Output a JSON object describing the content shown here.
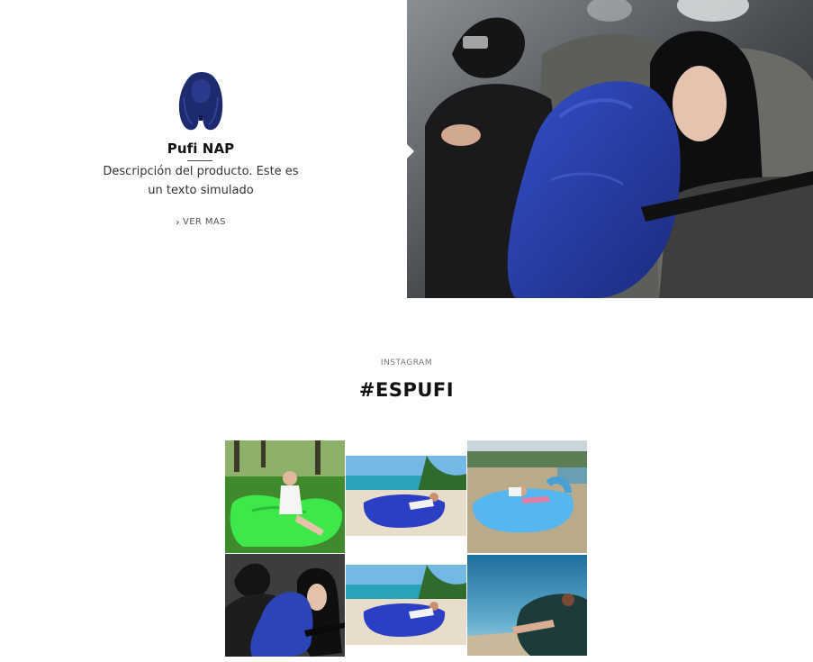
{
  "product": {
    "name": "Pufi NAP",
    "description": "Descripción del producto. Este es un texto simulado",
    "cta_label": "VER MAS",
    "cta_icon": "chevron-right-icon",
    "thumbnail": "inflatable-pillow-navy",
    "hero_image": "passengers-with-inflatable-pillow-on-plane"
  },
  "instagram": {
    "kicker": "INSTAGRAM",
    "heading": "#ESPUFI",
    "images": [
      "woman-on-green-air-lounger-in-park",
      "woman-on-blue-air-lounger-on-beach",
      "woman-reading-on-sky-blue-air-lounger",
      "passengers-with-inflatable-pillow-on-plane",
      "woman-on-blue-air-lounger-on-beach",
      "woman-on-dark-air-lounger-by-sea"
    ]
  },
  "colors": {
    "pillow_navy": "#23358f",
    "lounger_green": "#3ee84a",
    "lounger_blue": "#2b3fc4",
    "lounger_sky": "#56b6ef",
    "text_dark": "#111111"
  }
}
